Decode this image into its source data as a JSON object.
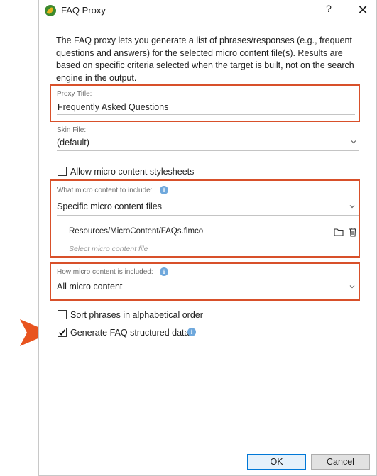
{
  "dialog": {
    "title": "FAQ Proxy",
    "help_label": "?",
    "close_label": "✕",
    "description": "The FAQ proxy lets you generate a list of phrases/responses (e.g., frequent questions and answers) for the selected micro content file(s). Results are based on specific criteria selected when the target is built, not on the search engine in the output."
  },
  "proxy_title": {
    "label": "Proxy Title:",
    "value": "Frequently Asked Questions"
  },
  "skin_file": {
    "label": "Skin File:",
    "value": "(default)"
  },
  "allow_stylesheets": {
    "label": "Allow micro content stylesheets",
    "checked": false
  },
  "what_to_include": {
    "label": "What micro content to include:",
    "value": "Specific micro content files",
    "file_path": "Resources/MicroContent/FAQs.flmco",
    "placeholder": "Select micro content file"
  },
  "how_included": {
    "label": "How micro content is included:",
    "value": "All micro content"
  },
  "sort_alpha": {
    "label": "Sort phrases in alphabetical order",
    "checked": false
  },
  "generate_faq": {
    "label": "Generate FAQ structured data",
    "checked": true
  },
  "buttons": {
    "ok": "OK",
    "cancel": "Cancel"
  },
  "colors": {
    "highlight_border": "#d8502a",
    "arrow": "#e8541f",
    "info_icon": "#6fa8dc",
    "accent": "#0078d7"
  },
  "icons": {
    "app": "flare-app-icon",
    "folder": "folder-icon",
    "delete": "trash-icon",
    "info": "info-icon",
    "dropdown": "chevron-down-icon",
    "pointer": "callout-arrow-icon"
  }
}
